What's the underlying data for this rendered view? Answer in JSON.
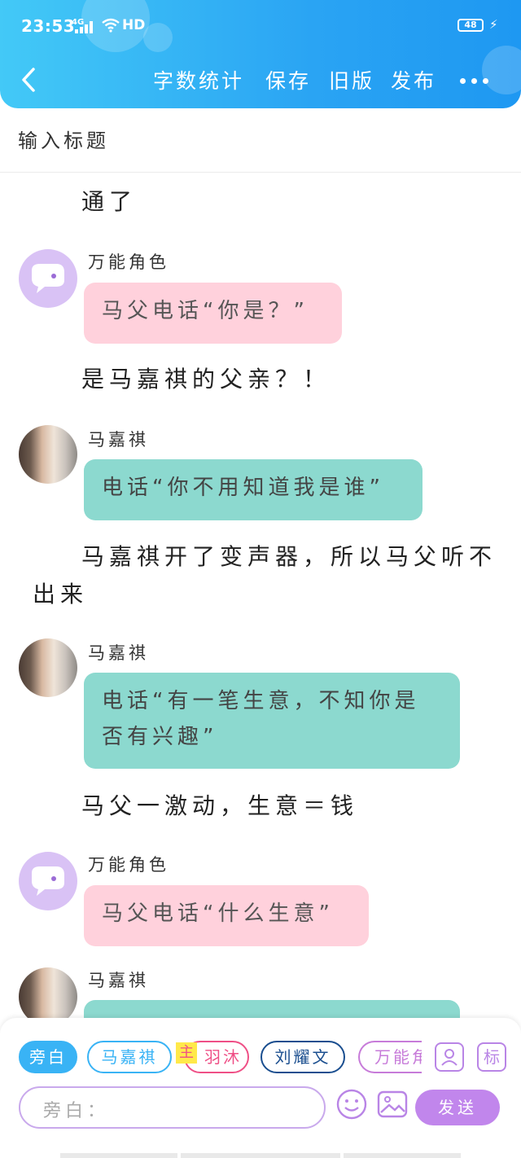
{
  "status_bar": {
    "time": "23:53",
    "network": "4G",
    "wifi_label": "HD",
    "battery": "48"
  },
  "toolbar": {
    "back_icon": "chevron-left-icon",
    "word_count": "字数统计",
    "save": "保存",
    "old_version": "旧版",
    "publish": "发布",
    "more_icon": "more-dots-icon"
  },
  "title_field": {
    "placeholder": "输入标题"
  },
  "colors": {
    "header": "#2aa4f3",
    "pink_bubble": "#ffd1dc",
    "teal_bubble": "#8cd9cf",
    "send": "#c186ec",
    "accent_blue": "#39b3f5"
  },
  "story": {
    "p1": "通了",
    "msg1": {
      "speaker": "万能角色",
      "text": "马父电话“你是？”"
    },
    "p2": "是马嘉祺的父亲？！",
    "msg2": {
      "speaker": "马嘉祺",
      "text": "电话“你不用知道我是谁”"
    },
    "p3_line1": "马嘉祺开了变声器，所以马父听不",
    "p3_line2": "出来",
    "msg3": {
      "speaker": "马嘉祺",
      "line1": "电话“有一笔生意，不知你是",
      "line2": "否有兴趣”"
    },
    "p4": "马父一激动，生意＝钱",
    "msg4": {
      "speaker": "万能角色",
      "text": "马父电话“什么生意”"
    },
    "msg5": {
      "speaker": "马嘉祺"
    }
  },
  "bottom_bar": {
    "roles": {
      "narrator": "旁白",
      "ma": "马嘉祺",
      "yu": "羽沐",
      "liu": "刘耀文",
      "wanneng": "万能角色"
    },
    "main_tag": "主",
    "tag_button": "标",
    "input_placeholder": "旁白：",
    "send": "发送"
  }
}
